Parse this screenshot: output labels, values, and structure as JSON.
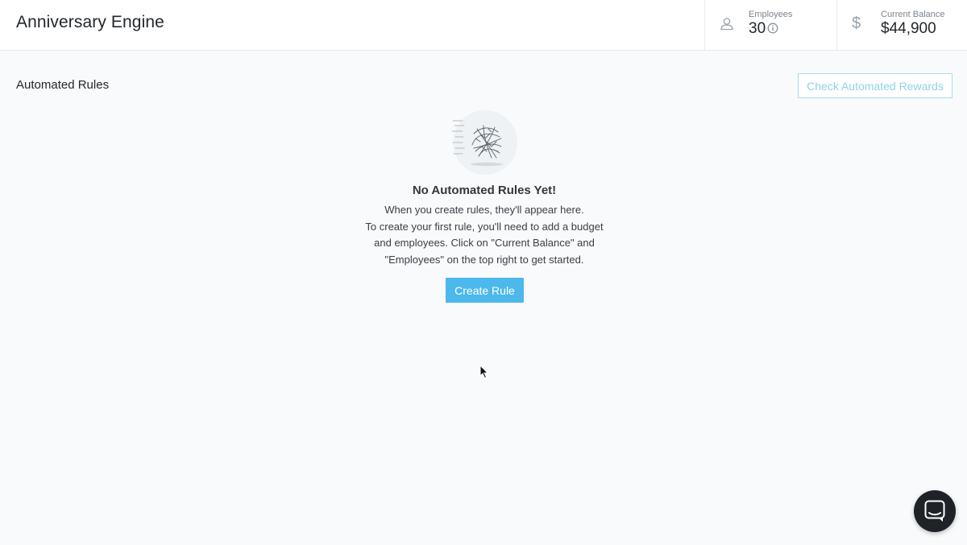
{
  "header": {
    "app_title": "Anniversary Engine",
    "employees": {
      "label": "Employees",
      "value": "30",
      "icon": "person-icon",
      "info_icon": "info-icon"
    },
    "balance": {
      "label": "Current Balance",
      "value": "$44,900",
      "icon": "dollar-icon"
    }
  },
  "main": {
    "section_title": "Automated Rules",
    "check_button_label": "Check Automated Rewards",
    "empty_state": {
      "illustration": "tumbleweed-illustration",
      "title": "No Automated Rules Yet!",
      "line1": "When you create rules, they'll appear here.",
      "line2": "To create your first rule, you'll need to add a budget",
      "line3": "and employees. Click on \"Current Balance\" and",
      "line4": "\"Employees\" on the top right to get started.",
      "button_label": "Create Rule"
    }
  },
  "chat": {
    "icon": "chat-icon"
  },
  "colors": {
    "accent": "#4cb8ec",
    "outline_button": "#8fd2e5",
    "background": "#f8fafc",
    "chat_launcher": "#1f2327"
  }
}
